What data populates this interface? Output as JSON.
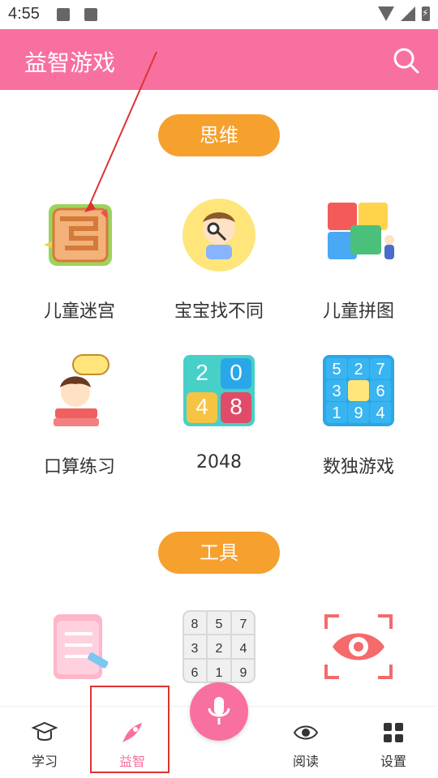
{
  "status": {
    "time": "4:55"
  },
  "appbar": {
    "title": "益智游戏"
  },
  "sections": {
    "thinking": {
      "label": "思维"
    },
    "tools": {
      "label": "工具"
    }
  },
  "games": [
    {
      "label": "儿童迷宫",
      "icon": "maze-icon"
    },
    {
      "label": "宝宝找不同",
      "icon": "boy-magnifier-icon"
    },
    {
      "label": "儿童拼图",
      "icon": "puzzle-icon"
    },
    {
      "label": "口算练习",
      "icon": "math-boy-icon"
    },
    {
      "label": "2048",
      "icon": "2048-icon"
    },
    {
      "label": "数独游戏",
      "icon": "sudoku-icon"
    }
  ],
  "tool_labels_partial": [
    {
      "label": ""
    },
    {
      "label": ""
    },
    {
      "label": ""
    }
  ],
  "tiles_2048": [
    "2",
    "0",
    "4",
    "8"
  ],
  "sudoku_tiles": [
    "5",
    "2",
    "7",
    "3",
    "",
    "6",
    "1",
    "9",
    "4"
  ],
  "tool_grid_numbers": [
    "8",
    "5",
    "7",
    "3",
    "2",
    "4",
    "6",
    "1",
    "9"
  ],
  "bottom_nav": [
    {
      "label": "学习"
    },
    {
      "label": "益智"
    },
    {
      "label": "阅读"
    },
    {
      "label": "设置"
    }
  ],
  "colors": {
    "accent_pink": "#f870a0",
    "accent_orange": "#f6a02e"
  }
}
